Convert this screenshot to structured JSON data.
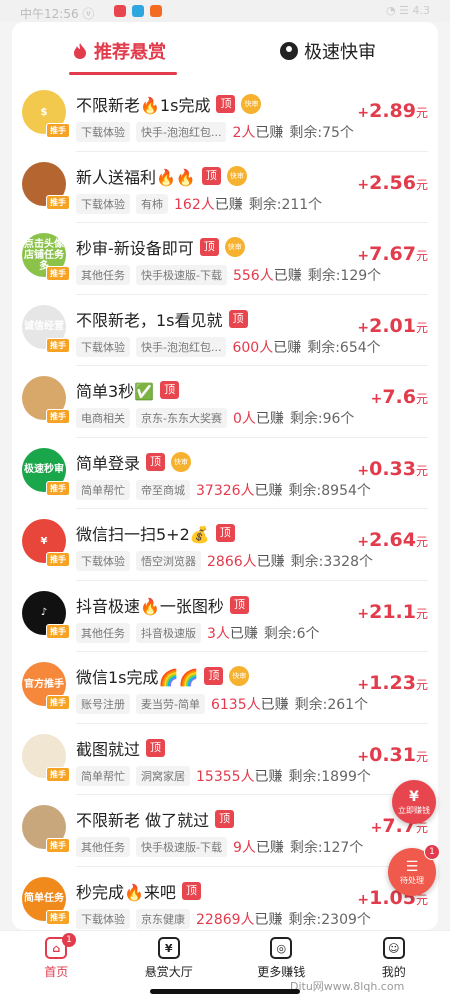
{
  "statusbar": {
    "time": "中午12:56 ⓥ",
    "right": "◔ ☰ 4.3"
  },
  "tabs": [
    {
      "label": "推荐悬赏",
      "active": true,
      "icon": "fire-icon"
    },
    {
      "label": "极速快审",
      "active": false,
      "icon": "user-icon"
    }
  ],
  "tags": {
    "top": "顶",
    "fast": "快审",
    "avatar_badge": "推手"
  },
  "labels": {
    "earned_suffix": "已赚",
    "remain_prefix": "剩余:",
    "unit": "元",
    "plus": "+"
  },
  "tasks": [
    {
      "title": "不限新老🔥1s完成",
      "fast": true,
      "cat": "下载体验",
      "src": "快手-泡泡红包...",
      "earned": "2人",
      "remain": "75个",
      "reward": "2.89",
      "avatar_color": "#f2c94c",
      "avatar_text": "$"
    },
    {
      "title": "新人送福利🔥🔥",
      "fast": true,
      "cat": "下载体验",
      "src": "有柿",
      "earned": "162人",
      "remain": "211个",
      "reward": "2.56",
      "avatar_color": "#b5652f",
      "avatar_text": ""
    },
    {
      "title": "秒审-新设备即可",
      "fast": true,
      "cat": "其他任务",
      "src": "快手极速版-下载",
      "earned": "556人",
      "remain": "129个",
      "reward": "7.67",
      "avatar_color": "#8bc34a",
      "avatar_text": "点击头像店铺任务多"
    },
    {
      "title": "不限新老，1s看见就",
      "fast": false,
      "cat": "下载体验",
      "src": "快手-泡泡红包...",
      "earned": "600人",
      "remain": "654个",
      "reward": "2.01",
      "avatar_color": "#e6e6e6",
      "avatar_text": "诚信经营"
    },
    {
      "title": "简单3秒✅",
      "fast": false,
      "cat": "电商相关",
      "src": "京东-东东大奖赛",
      "earned": "0人",
      "remain": "96个",
      "reward": "7.6",
      "avatar_color": "#d8a86a",
      "avatar_text": ""
    },
    {
      "title": "简单登录",
      "fast": true,
      "cat": "简单帮忙",
      "src": "帝至商城",
      "earned": "37326人",
      "remain": "8954个",
      "reward": "0.33",
      "avatar_color": "#1aa64a",
      "avatar_text": "极速秒审"
    },
    {
      "title": "微信扫一扫5+2💰",
      "fast": false,
      "cat": "下载体验",
      "src": "悟空浏览器",
      "earned": "2866人",
      "remain": "3328个",
      "reward": "2.64",
      "avatar_color": "#e8463a",
      "avatar_text": "¥"
    },
    {
      "title": "抖音极速🔥一张图秒",
      "fast": false,
      "cat": "其他任务",
      "src": "抖音极速版",
      "earned": "3人",
      "remain": "6个",
      "reward": "21.1",
      "avatar_color": "#111111",
      "avatar_text": "♪"
    },
    {
      "title": "微信1s完成🌈🌈",
      "fast": true,
      "cat": "账号注册",
      "src": "麦当劳-简单",
      "earned": "6135人",
      "remain": "261个",
      "reward": "1.23",
      "avatar_color": "#f5883a",
      "avatar_text": "官方推手"
    },
    {
      "title": "截图就过",
      "fast": false,
      "cat": "简单帮忙",
      "src": "洞窝家居",
      "earned": "15355人",
      "remain": "1899个",
      "reward": "0.31",
      "avatar_color": "#f0e6d2",
      "avatar_text": ""
    },
    {
      "title": "不限新老 做了就过",
      "fast": false,
      "cat": "其他任务",
      "src": "快手极速版-下载",
      "earned": "9人",
      "remain": "127个",
      "reward": "7.7",
      "avatar_color": "#c9a77c",
      "avatar_text": ""
    },
    {
      "title": "秒完成🔥来吧",
      "fast": false,
      "cat": "下载体验",
      "src": "京东健康",
      "earned": "22869人",
      "remain": "2309个",
      "reward": "1.05",
      "avatar_color": "#f08a1c",
      "avatar_text": "简单任务"
    }
  ],
  "floating": {
    "earn": {
      "glyph": "¥",
      "label": "立即赚钱"
    },
    "pending": {
      "glyph": "☰",
      "label": "待处理",
      "count": "1"
    }
  },
  "nav": [
    {
      "label": "首页",
      "icon": "home-icon",
      "glyph": "⌂",
      "active": true,
      "badge": "1"
    },
    {
      "label": "悬赏大厅",
      "icon": "reward-hall-icon",
      "glyph": "¥",
      "active": false
    },
    {
      "label": "更多赚钱",
      "icon": "gamepad-icon",
      "glyph": "◎",
      "active": false
    },
    {
      "label": "我的",
      "icon": "profile-icon",
      "glyph": "☺",
      "active": false
    }
  ],
  "watermark": "Ditu网www.8lqh.com",
  "colors": {
    "accent": "#e23b4c",
    "tag_red": "#e8464e",
    "fast_badge": "#f6b22e"
  }
}
